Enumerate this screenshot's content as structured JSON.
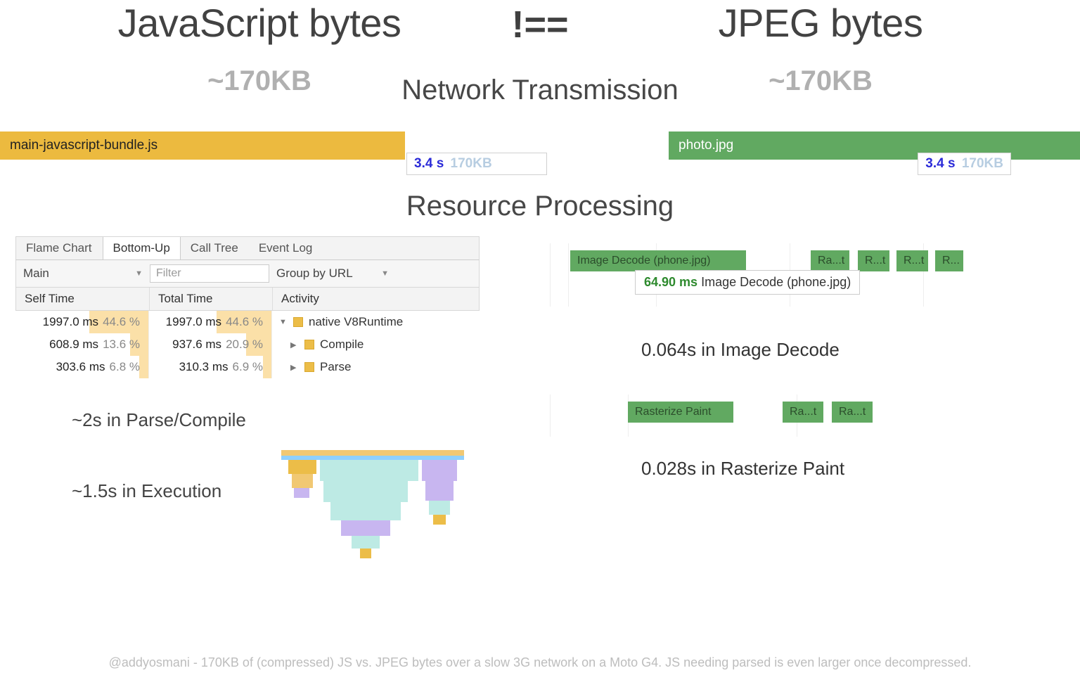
{
  "header": {
    "left_title": "JavaScript bytes",
    "right_title": "JPEG bytes",
    "not_equal": "!==",
    "left_size": "~170KB",
    "right_size": "~170KB"
  },
  "sections": {
    "network": "Network Transmission",
    "resource": "Resource Processing"
  },
  "network": {
    "left_file": "main-javascript-bundle.js",
    "right_file": "photo.jpg",
    "left_time": "3.4 s",
    "left_kb": "170KB",
    "right_time": "3.4 s",
    "right_kb": "170KB"
  },
  "panel": {
    "tabs": [
      "Flame Chart",
      "Bottom-Up",
      "Call Tree",
      "Event Log"
    ],
    "active_tab": 1,
    "thread": "Main",
    "filter_placeholder": "Filter",
    "group": "Group by URL",
    "columns": [
      "Self Time",
      "Total Time",
      "Activity"
    ]
  },
  "chart_data": {
    "type": "table",
    "title": "Bottom-Up profile",
    "columns": [
      "self_ms",
      "self_pct",
      "total_ms",
      "total_pct",
      "activity",
      "depth"
    ],
    "rows": [
      {
        "self_ms": 1997.0,
        "self_pct": 44.6,
        "total_ms": 1997.0,
        "total_pct": 44.6,
        "activity": "native V8Runtime",
        "depth": 0
      },
      {
        "self_ms": 608.9,
        "self_pct": 13.6,
        "total_ms": 937.6,
        "total_pct": 20.9,
        "activity": "Compile",
        "depth": 1
      },
      {
        "self_ms": 303.6,
        "self_pct": 6.8,
        "total_ms": 310.3,
        "total_pct": 6.9,
        "activity": "Parse",
        "depth": 1
      }
    ]
  },
  "js_cost": {
    "parse_compile": "~2s in Parse/Compile",
    "execution": "~1.5s in Execution"
  },
  "image_timeline": {
    "main_block": "Image Decode (phone.jpg)",
    "tooltip_ms": "64.90 ms",
    "tooltip_txt": "Image Decode (phone.jpg)",
    "blocks": [
      "Ra...t",
      "R...t",
      "R...t",
      "R..."
    ]
  },
  "image_cost": {
    "decode": "0.064s in Image Decode",
    "raster_block": "Rasterize Paint",
    "raster_small": [
      "Ra...t",
      "Ra...t"
    ],
    "raster": "0.028s in Rasterize Paint"
  },
  "footnote": "@addyosmani - 170KB of (compressed) JS vs. JPEG bytes over a slow 3G network on a Moto G4. JS needing parsed is even larger once decompressed."
}
